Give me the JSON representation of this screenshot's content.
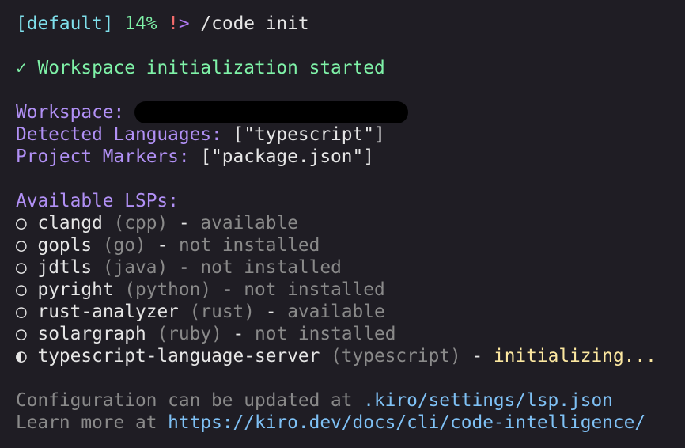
{
  "prompt": {
    "profile": "[default]",
    "percent": "14%",
    "bang": "!",
    "arrow": ">",
    "command": "/code init"
  },
  "status": {
    "icon": "✓",
    "text": "Workspace initialization started"
  },
  "info": {
    "workspace_label": "Workspace:",
    "languages_label": "Detected Languages:",
    "languages_value": "[\"typescript\"]",
    "markers_label": "Project Markers:",
    "markers_value": "[\"package.json\"]"
  },
  "lsps_title": "Available LSPs:",
  "lsps": [
    {
      "icon": "○",
      "name": "clangd",
      "lang": "(cpp)",
      "sep": "-",
      "status": "available"
    },
    {
      "icon": "○",
      "name": "gopls",
      "lang": "(go)",
      "sep": "-",
      "status": "not installed"
    },
    {
      "icon": "○",
      "name": "jdtls",
      "lang": "(java)",
      "sep": "-",
      "status": "not installed"
    },
    {
      "icon": "○",
      "name": "pyright",
      "lang": "(python)",
      "sep": "-",
      "status": "not installed"
    },
    {
      "icon": "○",
      "name": "rust-analyzer",
      "lang": "(rust)",
      "sep": "-",
      "status": "available"
    },
    {
      "icon": "○",
      "name": "solargraph",
      "lang": "(ruby)",
      "sep": "-",
      "status": "not installed"
    },
    {
      "icon": "◐",
      "name": "typescript-language-server",
      "lang": "(typescript)",
      "sep": "-",
      "status": "initializing..."
    }
  ],
  "footer": {
    "config_text": "Configuration can be updated at",
    "config_path": ".kiro/settings/lsp.json",
    "learn_text": "Learn more at",
    "learn_url": "https://kiro.dev/docs/cli/code-intelligence/"
  }
}
